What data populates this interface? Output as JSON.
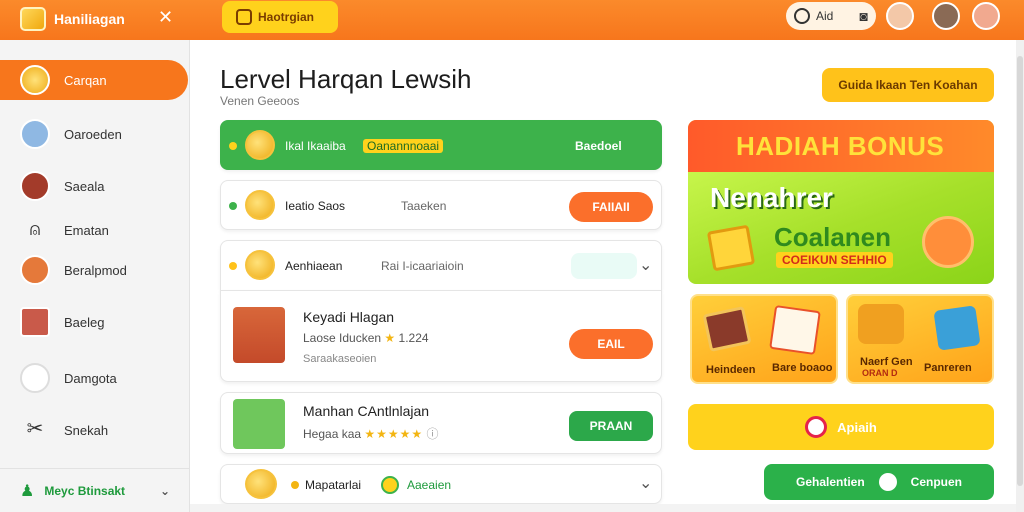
{
  "app": {
    "title": "Haniliagan",
    "top_button": "Haotrgian",
    "top_right_label": "Aid"
  },
  "sidebar": {
    "items": [
      {
        "label": "Carqan",
        "icon": "coin-icon",
        "active": true
      },
      {
        "label": "Oaroeden",
        "icon": "gamepad-icon"
      },
      {
        "label": "Saeala",
        "icon": "character-icon"
      },
      {
        "label": "Ematan",
        "icon": "bell-icon"
      },
      {
        "label": "Beralpmod",
        "icon": "face-icon"
      },
      {
        "label": "Baeleg",
        "icon": "castle-icon"
      },
      {
        "label": "Damgota",
        "icon": "controller-icon"
      },
      {
        "label": "Snekah",
        "icon": "tools-icon"
      }
    ],
    "footer_label": "Meyc Btinsakt"
  },
  "main": {
    "title": "Lervel Harqan Lewsih",
    "subtitle": "Venen Geeoos",
    "top_right_button": "Guida Ikaan Ten Koahan",
    "rows": [
      {
        "title": "Ikal Ikaaiba",
        "tag": "Oanannnoaai",
        "action": "Baedoel"
      },
      {
        "title": "Ieatio Saos",
        "tag": "Taaeken",
        "action": "FAIIAII"
      },
      {
        "title": "Aenhiaean",
        "tag": "Rai I-icaariaioin",
        "action": ""
      },
      {
        "title": "Keyadi Hlagan",
        "meta": "Laose Iducken",
        "meta_value": "1.224",
        "subtext": "Saraakaseoien",
        "action": "EAIL"
      },
      {
        "title": "Manhan CAntlnlajan",
        "meta": "Hegaa kaa",
        "rating": 5,
        "action": "PRAAN"
      },
      {
        "title": "Mapatarlai",
        "tag": "Aaeaien",
        "action": ""
      }
    ]
  },
  "banner": {
    "top_text": "HADIAH BONUS",
    "big_text": "Nenahrer",
    "mid_text": "Coalanen",
    "small_text": "COEIKUN SEHHIO"
  },
  "tiles": [
    {
      "left_label": "Heindeen",
      "right_label": "Bare boaoo"
    },
    {
      "left_label": "Naerf Gen",
      "left_sub": "ORAN D",
      "right_label": "Panreren"
    }
  ],
  "actions": {
    "wide_button": "Apiaih",
    "green_button_left": "Gehalentien",
    "green_button_right": "Cenpuen"
  },
  "colors": {
    "accent": "#f7761c",
    "green": "#3db24b",
    "yellow": "#ffd21c",
    "orange_button": "#fb6f2b"
  }
}
